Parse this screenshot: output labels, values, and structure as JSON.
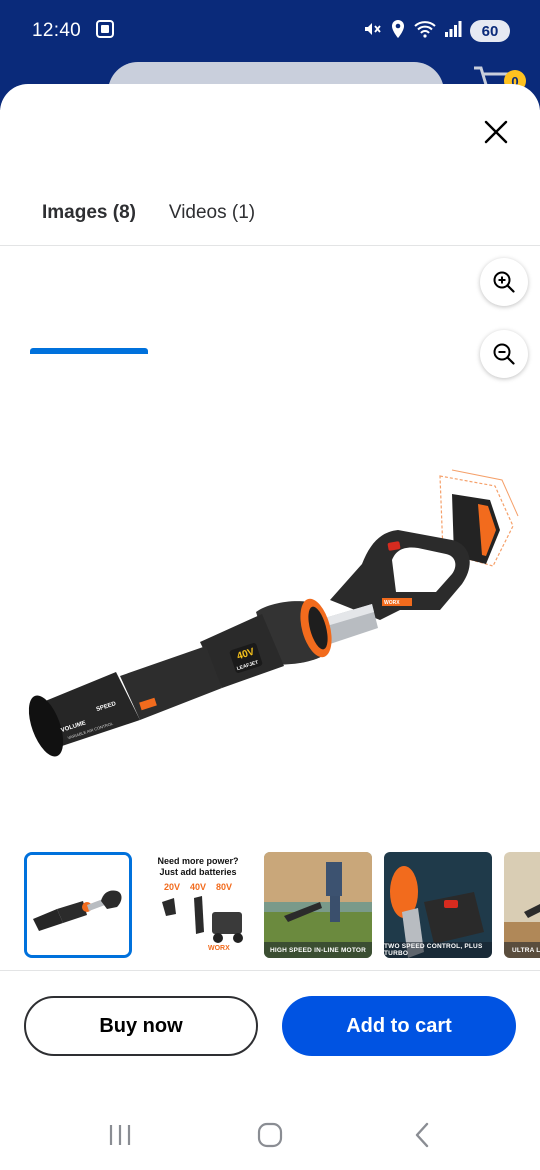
{
  "status_bar": {
    "time": "12:40",
    "battery": "60"
  },
  "background": {
    "cart_count": "0"
  },
  "tabs": [
    {
      "label": "Images (8)",
      "selected": true
    },
    {
      "label": "Videos (1)",
      "selected": false
    }
  ],
  "main_image": {
    "product_text": "40V",
    "collar_text": "LEAFJET",
    "nozzle_label_left": "VOLUME",
    "nozzle_label_right": "SPEED",
    "nozzle_sub": "VARIABLE AIR CONTROL",
    "brand": "WORX"
  },
  "thumbnails": [
    {
      "caption": "",
      "selected": true
    },
    {
      "caption": "",
      "title": "Need more power? Just add batteries",
      "volts": [
        "20V",
        "40V",
        "80V"
      ],
      "brand": "WORX"
    },
    {
      "caption": "HIGH SPEED IN-LINE MOTOR"
    },
    {
      "caption": "TWO SPEED CONTROL, PLUS TURBO"
    },
    {
      "caption": "ULTRA LIG"
    }
  ],
  "actions": {
    "buy_now": "Buy now",
    "add_to_cart": "Add to cart"
  },
  "colors": {
    "header_blue": "#0a2a7a",
    "accent_blue": "#0071dc",
    "cart_button": "#0053e2",
    "worx_orange": "#f26b1d"
  }
}
